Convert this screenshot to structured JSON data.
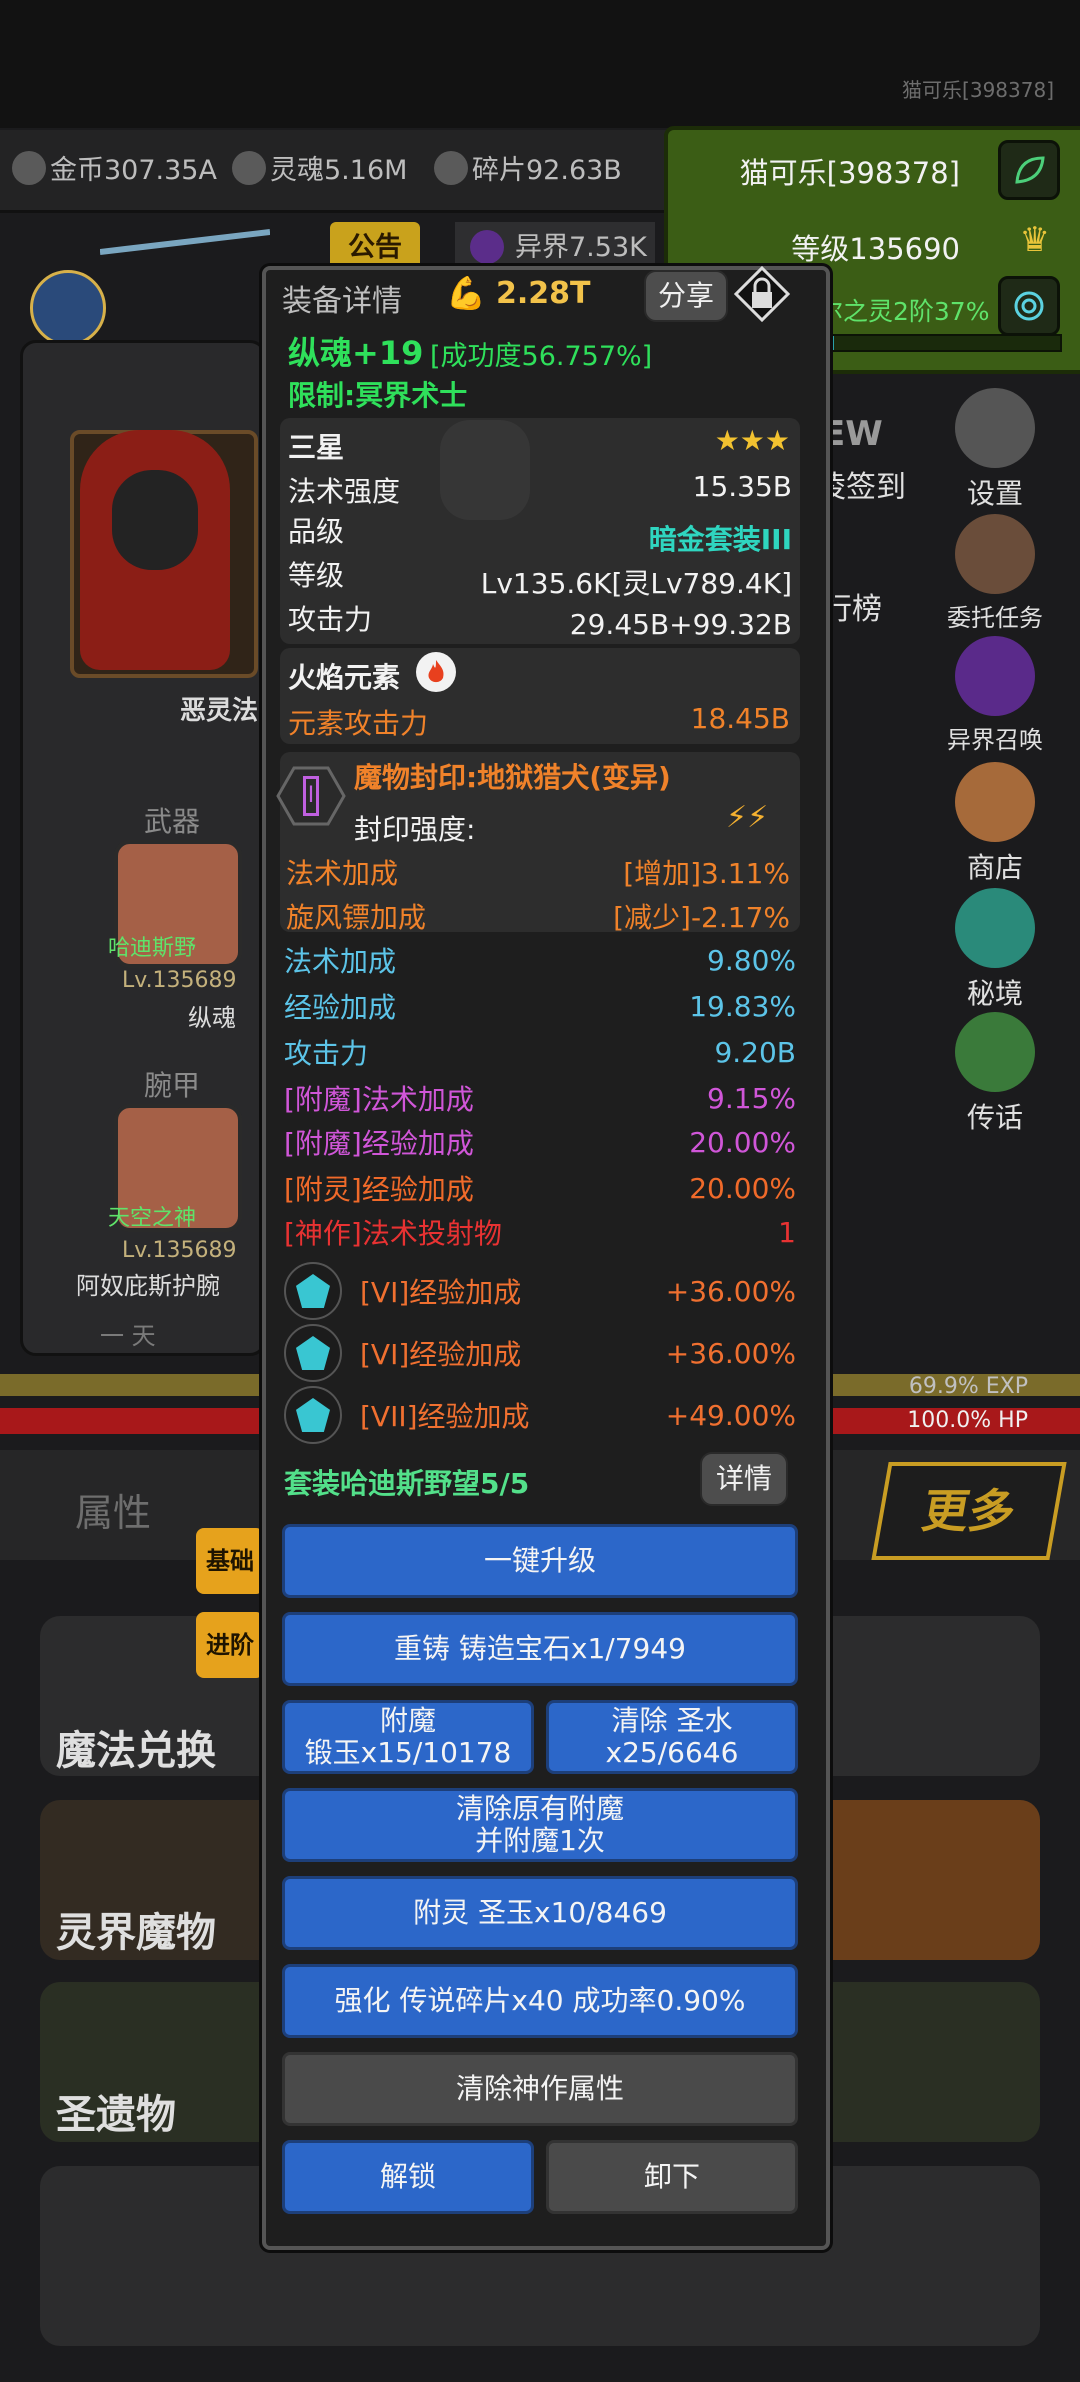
{
  "header": {
    "player_corner": "猫可乐[398378]",
    "resources": [
      {
        "icon": "gold-coin-icon",
        "label": "金币307.35A"
      },
      {
        "icon": "soul-icon",
        "label": "灵魂5.16M"
      },
      {
        "icon": "shard-icon",
        "label": "碎片92.63B"
      }
    ],
    "player_name": "猫可乐[398378]",
    "level": "等级135690",
    "spirit": "尔之灵2阶37%",
    "notice": "公告",
    "otherworld": "异界7.53K"
  },
  "character": {
    "name": "恶灵法",
    "slots": [
      {
        "category": "武器",
        "item_set": "哈迪斯野",
        "level": "Lv.135689",
        "item_name": "纵魂"
      },
      {
        "category": "腕甲",
        "item_set": "天空之神",
        "level": "Lv.135689",
        "item_name": "阿奴庇斯护腕"
      }
    ],
    "bottom_text": "一 天"
  },
  "right_menu": [
    {
      "label": "设置",
      "icon": "gear-icon"
    },
    {
      "label": "委托任务",
      "icon": "quest-icon"
    },
    {
      "label": "异界召唤",
      "icon": "portal-icon"
    },
    {
      "label": "商店",
      "icon": "shop-icon"
    },
    {
      "label": "秘境",
      "icon": "secret-realm-icon"
    },
    {
      "label": "传话",
      "icon": "megaphone-icon"
    }
  ],
  "right_partial": {
    "new": "EW",
    "checkin": "凌签到",
    "rank": "行榜"
  },
  "bars": {
    "exp": "69.9% EXP",
    "exp_fraction": 0.699,
    "hp": "100.0% HP",
    "hp_fraction": 1.0
  },
  "tabs": {
    "attr": "属性",
    "more": "更多"
  },
  "cards": [
    {
      "title": "魔法兑换"
    },
    {
      "title": "灵界魔物"
    },
    {
      "title": "圣遗物"
    }
  ],
  "side_tags": {
    "basic": "基础",
    "advanced": "进阶"
  },
  "modal": {
    "title": "装备详情",
    "power": "2.28T",
    "share": "分享",
    "item_name": "纵魂+19",
    "success": "[成功度56.757%]",
    "restriction": "限制:冥界术士",
    "base": {
      "grade": "三星",
      "stars": "★★★",
      "rows": [
        {
          "label": "法术强度",
          "value": "15.35B"
        },
        {
          "label": "品级",
          "value": "暗金套装III"
        },
        {
          "label": "等级",
          "value": "Lv135.6K[灵Lv789.4K]"
        },
        {
          "label": "攻击力",
          "value": "29.45B+99.32B"
        }
      ]
    },
    "element": {
      "title": "火焰元素",
      "label": "元素攻击力",
      "value": "18.45B"
    },
    "seal": {
      "roman": "I",
      "title": "魔物封印:地狱猎犬(变异)",
      "strength_label": "封印强度:",
      "rows": [
        {
          "label": "法术加成",
          "value": "[增加]3.11%"
        },
        {
          "label": "旋风镖加成",
          "value": "[减少]-2.17%"
        }
      ]
    },
    "stats": [
      {
        "label": "法术加成",
        "value": "9.80%",
        "color": "#5cc4e8"
      },
      {
        "label": "经验加成",
        "value": "19.83%",
        "color": "#5cc4e8"
      },
      {
        "label": "攻击力",
        "value": "9.20B",
        "color": "#5cc4e8"
      },
      {
        "label": "[附魔]法术加成",
        "value": "9.15%",
        "color": "#d056d8"
      },
      {
        "label": "[附魔]经验加成",
        "value": "20.00%",
        "color": "#d056d8"
      },
      {
        "label": "[附灵]经验加成",
        "value": "20.00%",
        "color": "#f06a2a"
      },
      {
        "label": "[神作]法术投射物",
        "value": "1",
        "color": "#e83232"
      }
    ],
    "gems": [
      {
        "label": "[VI]经验加成",
        "value": "+36.00%"
      },
      {
        "label": "[VI]经验加成",
        "value": "+36.00%"
      },
      {
        "label": "[VII]经验加成",
        "value": "+49.00%"
      }
    ],
    "set": {
      "label": "套装哈迪斯野望5/5",
      "detail": "详情"
    },
    "buttons": {
      "upgrade": "一键升级",
      "reforge": "重铸 铸造宝石x1/7949",
      "enchant_l1": "附魔",
      "enchant_l2": "锻玉x15/10178",
      "clear_holy": "清除 圣水x25/6646",
      "clear_reenchant_l1": "清除原有附魔",
      "clear_reenchant_l2": "并附魔1次",
      "spirit": "附灵 圣玉x10/8469",
      "strengthen": "强化 传说碎片x40 成功率0.90%",
      "clear_divine": "清除神作属性",
      "unlock": "解锁",
      "unequip": "卸下"
    }
  },
  "colors": {
    "accent_blue": "#2c67c9",
    "item_green": "#2fe05b",
    "gold_tag": "#e6a21c",
    "element_orange": "#f0822a",
    "set_green": "#53e08a",
    "grade_cyan": "#2fd6c0"
  }
}
